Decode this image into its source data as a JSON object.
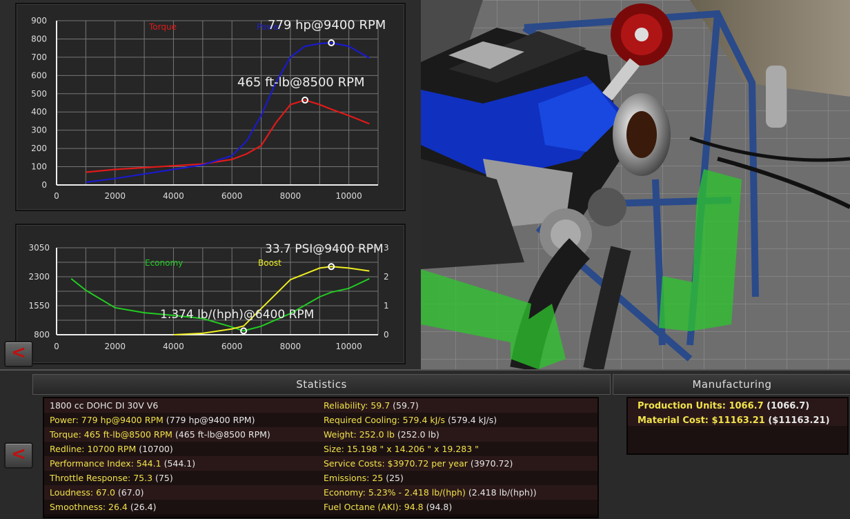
{
  "power_chart": {
    "legend_torque": "Torque",
    "legend_power": "Power",
    "peak_power_label": "779 hp@9400 RPM",
    "peak_torque_label": "465 ft-lb@8500 RPM",
    "y_ticks": [
      "900",
      "800",
      "700",
      "600",
      "500",
      "400",
      "300",
      "200",
      "100",
      "0"
    ],
    "x_ticks": [
      "0",
      "2000",
      "4000",
      "6000",
      "8000",
      "10000"
    ],
    "colors": {
      "torque": "#e01a1a",
      "power": "#1a1acc"
    }
  },
  "econ_chart": {
    "legend_economy": "Economy",
    "legend_boost": "Boost",
    "peak_boost_label": "33.7 PSI@9400 RPM",
    "min_economy_label": "1.374 lb/(hph)@6400 RPM",
    "y_left_ticks": [
      "3050",
      "2300",
      "1550",
      "800"
    ],
    "y_right_ticks": [
      "3",
      "2",
      "1",
      "0"
    ],
    "x_ticks": [
      "0",
      "2000",
      "4000",
      "6000",
      "8000",
      "10000"
    ],
    "colors": {
      "economy": "#22cc22",
      "boost": "#eeee22"
    }
  },
  "chart_data": [
    {
      "type": "line",
      "x": [
        1000,
        2000,
        3000,
        4000,
        5000,
        6000,
        6500,
        7000,
        7500,
        8000,
        8500,
        9000,
        9400,
        10000,
        10700
      ],
      "series": [
        {
          "name": "Torque",
          "values": [
            70,
            85,
            95,
            105,
            115,
            140,
            170,
            215,
            340,
            440,
            465,
            440,
            415,
            380,
            335
          ]
        },
        {
          "name": "Power",
          "values": [
            15,
            35,
            60,
            85,
            110,
            160,
            240,
            380,
            560,
            700,
            760,
            775,
            779,
            760,
            695
          ]
        }
      ],
      "xlim": [
        0,
        11000
      ],
      "ylim": [
        0,
        900
      ],
      "annotations": [
        "779 hp@9400 RPM",
        "465 ft-lb@8500 RPM"
      ],
      "grid": true
    },
    {
      "type": "line",
      "x": [
        500,
        1000,
        2000,
        3000,
        4000,
        5000,
        6000,
        6400,
        7000,
        8000,
        9000,
        9400,
        10000,
        10700
      ],
      "series": [
        {
          "name": "Economy",
          "values": [
            2250,
            1950,
            1500,
            1370,
            1300,
            1220,
            1000,
            900,
            1020,
            1350,
            1780,
            1900,
            2000,
            2250
          ]
        },
        {
          "name": "Boost",
          "values": [
            null,
            null,
            null,
            null,
            0,
            0.05,
            0.2,
            0.3,
            0.9,
            1.9,
            2.3,
            2.35,
            2.3,
            2.2
          ]
        }
      ],
      "xlim": [
        0,
        11000
      ],
      "ylim": [
        800,
        3050
      ],
      "y2lim": [
        0,
        3
      ],
      "annotations": [
        "33.7 PSI@9400 RPM",
        "1.374 lb/(hph)@6400 RPM"
      ],
      "grid": true
    }
  ],
  "statistics": {
    "title": "Statistics",
    "left": [
      {
        "label": "1800 cc DOHC DI 30V V6",
        "value": ""
      },
      {
        "label": "Power: 779 hp@9400 RPM",
        "value": "(779 hp@9400 RPM)"
      },
      {
        "label": "Torque: 465 ft-lb@8500 RPM",
        "value": "(465 ft-lb@8500 RPM)"
      },
      {
        "label": "Redline: 10700 RPM",
        "value": "(10700)"
      },
      {
        "label": "Performance Index: 544.1",
        "value": "(544.1)"
      },
      {
        "label": "Throttle Response: 75.3",
        "value": "(75)"
      },
      {
        "label": "Loudness: 67.0",
        "value": "(67.0)"
      },
      {
        "label": "Smoothness: 26.4",
        "value": "(26.4)"
      }
    ],
    "right": [
      {
        "label": "Reliability: 59.7",
        "value": "(59.7)"
      },
      {
        "label": "Required Cooling: 579.4 kJ/s",
        "value": "(579.4 kJ/s)"
      },
      {
        "label": "Weight: 252.0 lb",
        "value": "(252.0 lb)"
      },
      {
        "label": "Size: 15.198 \" x 14.206 \" x 19.283 \"",
        "value": ""
      },
      {
        "label": "Service Costs: $3970.72 per year",
        "value": "(3970.72)"
      },
      {
        "label": "Emissions: 25",
        "value": "(25)"
      },
      {
        "label": "Economy: 5.23% - 2.418 lb/(hph)",
        "value": "(2.418 lb/(hph))"
      },
      {
        "label": "Fuel Octane (AKI): 94.8",
        "value": "(94.8)"
      }
    ]
  },
  "manufacturing": {
    "title": "Manufacturing",
    "items": [
      {
        "label": "Production Units: 1066.7",
        "value": "(1066.7)"
      },
      {
        "label": "Material Cost: $11163.21",
        "value": "($11163.21)"
      }
    ]
  },
  "back_buttons": {
    "top": "<",
    "bottom": "<"
  }
}
